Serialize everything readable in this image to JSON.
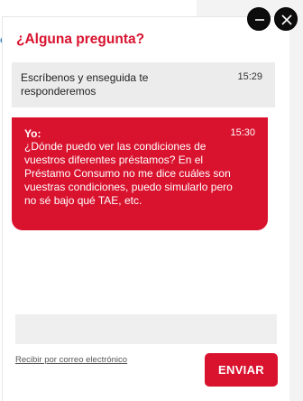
{
  "background": {
    "link_fragment": "os"
  },
  "chat": {
    "title": "¿Alguna pregunta?",
    "controls": {
      "minimize_icon": "minus-icon",
      "close_icon": "close-icon"
    },
    "messages": [
      {
        "author": "",
        "text": "Escríbenos y enseguida te responderemos",
        "time": "15:29"
      },
      {
        "author": "Yo:",
        "text": "¿Dónde puedo ver las condiciones de vuestros diferentes préstamos? En el Préstamo Consumo no me dice cuáles son vuestras condiciones, puedo simularlo pero no sé bajo qué TAE, etc.",
        "time": "15:30"
      }
    ],
    "input": {
      "value": "",
      "placeholder": ""
    },
    "email_link": "Recibir por correo electrónico",
    "send_label": "ENVIAR"
  },
  "colors": {
    "accent": "#d9122e",
    "agent_bubble": "#ececec",
    "control_bg": "#0d0d0d"
  }
}
